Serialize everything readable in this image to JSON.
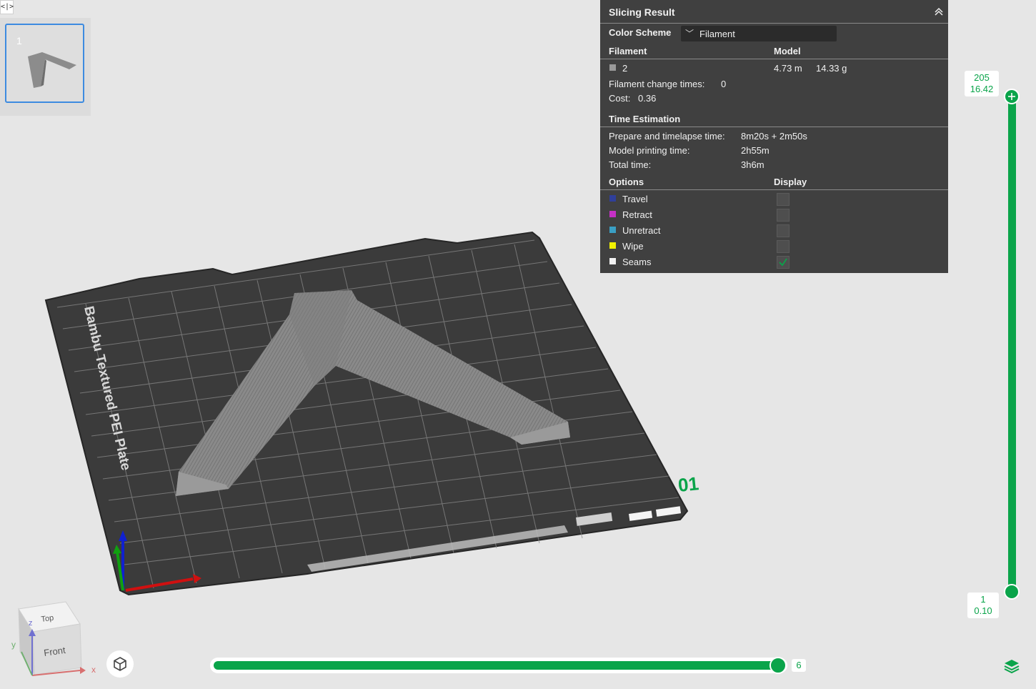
{
  "topbar": {
    "collapse_label": "<|>"
  },
  "plate_list": {
    "items": [
      {
        "number": "1"
      }
    ]
  },
  "slicing_result": {
    "title": "Slicing Result",
    "color_scheme": {
      "label": "Color Scheme",
      "value": "Filament"
    },
    "filament_table": {
      "col1": "Filament",
      "col2": "Model",
      "rows": [
        {
          "swatch": "#9a9a9a",
          "name": "2",
          "length": "4.73 m",
          "weight": "14.33 g"
        }
      ]
    },
    "filament_change": {
      "label": "Filament change times:",
      "value": "0"
    },
    "cost": {
      "label": "Cost:",
      "value": "0.36"
    },
    "time_estimation": {
      "title": "Time Estimation",
      "rows": [
        {
          "label": "Prepare and timelapse time:",
          "value": "8m20s + 2m50s"
        },
        {
          "label": "Model printing time:",
          "value": "2h55m"
        },
        {
          "label": "Total time:",
          "value": "3h6m"
        }
      ]
    },
    "options": {
      "col1": "Options",
      "col2": "Display",
      "items": [
        {
          "label": "Travel",
          "color": "#2f3f9a",
          "checked": false
        },
        {
          "label": "Retract",
          "color": "#c530c5",
          "checked": false
        },
        {
          "label": "Unretract",
          "color": "#3a9fc4",
          "checked": false
        },
        {
          "label": "Wipe",
          "color": "#f0f000",
          "checked": false
        },
        {
          "label": "Seams",
          "color": "#f2f2f2",
          "checked": true
        }
      ]
    }
  },
  "plate": {
    "label": "Bambu Textured PEI Plate",
    "plate_number": "01"
  },
  "view_cube": {
    "top_label": "Top",
    "front_label": "Front",
    "axis_x": "x",
    "axis_y": "y",
    "axis_z": "z"
  },
  "layer_slider": {
    "top_layer": "205",
    "top_height": "16.42",
    "bottom_layer": "1",
    "bottom_height": "0.10"
  },
  "move_slider": {
    "value": "6"
  },
  "colors": {
    "accent": "#0aa44a",
    "panel_bg": "#404040",
    "plate_bg": "#3b3b3b"
  }
}
